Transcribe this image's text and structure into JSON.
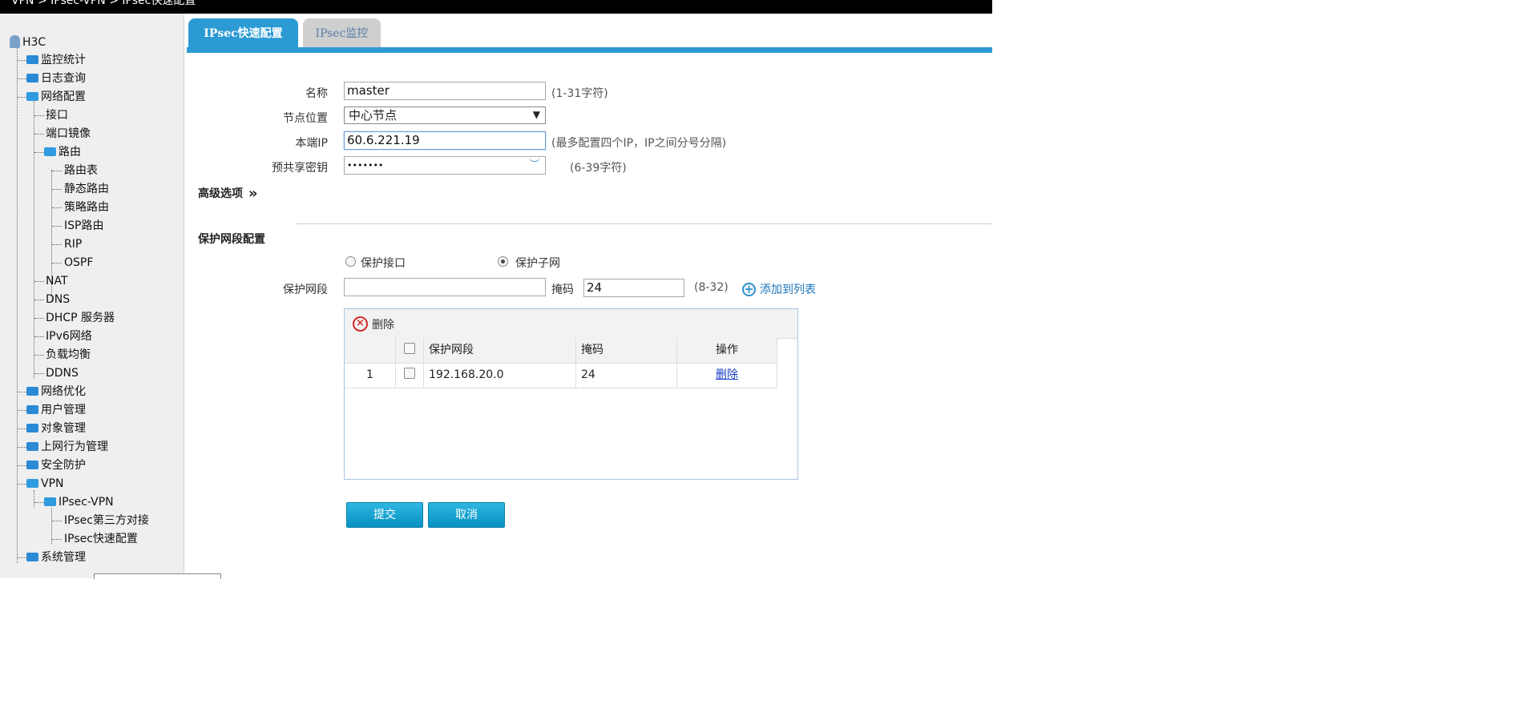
{
  "breadcrumb": "VPN > IPsec-VPN > IPsec快速配置",
  "sidebar": {
    "root": "H3C",
    "items": [
      {
        "label": "监控统计"
      },
      {
        "label": "日志查询"
      },
      {
        "label": "网络配置"
      },
      {
        "label": "接口"
      },
      {
        "label": "端口镜像"
      },
      {
        "label": "路由"
      },
      {
        "label": "路由表"
      },
      {
        "label": "静态路由"
      },
      {
        "label": "策略路由"
      },
      {
        "label": "ISP路由"
      },
      {
        "label": "RIP"
      },
      {
        "label": "OSPF"
      },
      {
        "label": "NAT"
      },
      {
        "label": "DNS"
      },
      {
        "label": "DHCP 服务器"
      },
      {
        "label": "IPv6网络"
      },
      {
        "label": "负载均衡"
      },
      {
        "label": "DDNS"
      },
      {
        "label": "网络优化"
      },
      {
        "label": "用户管理"
      },
      {
        "label": "对象管理"
      },
      {
        "label": "上网行为管理"
      },
      {
        "label": "安全防护"
      },
      {
        "label": "VPN"
      },
      {
        "label": "IPsec-VPN"
      },
      {
        "label": "IPsec第三方对接"
      },
      {
        "label": "IPsec快速配置"
      },
      {
        "label": "系统管理"
      }
    ]
  },
  "tabs": {
    "active": "IPsec快速配置",
    "inactive": "IPsec监控"
  },
  "form": {
    "name_label": "名称",
    "name_value": "master",
    "name_hint": "(1-31字符)",
    "node_label": "节点位置",
    "node_value": "中心节点",
    "local_ip_label": "本端IP",
    "local_ip_value": "60.6.221.19",
    "local_ip_hint": "(最多配置四个IP，IP之间分号分隔)",
    "psk_label": "预共享密钥",
    "psk_value": "•••••••",
    "psk_hint": "(6-39字符)",
    "advanced_label": "高级选项",
    "advanced_arrow": "»"
  },
  "protect": {
    "section_title": "保护网段配置",
    "radio_interface": "保护接口",
    "radio_subnet": "保护子网",
    "segment_label": "保护网段",
    "segment_value": "",
    "mask_label": "掩码",
    "mask_value": "24",
    "mask_hint": "(8-32)",
    "add_label": "添加到列表"
  },
  "table": {
    "delete_label": "删除",
    "headers": [
      "保护网段",
      "掩码",
      "操作"
    ],
    "rows": [
      {
        "index": "1",
        "segment": "192.168.20.0",
        "mask": "24",
        "action": "删除"
      }
    ]
  },
  "buttons": {
    "submit": "提交",
    "cancel": "取消"
  }
}
